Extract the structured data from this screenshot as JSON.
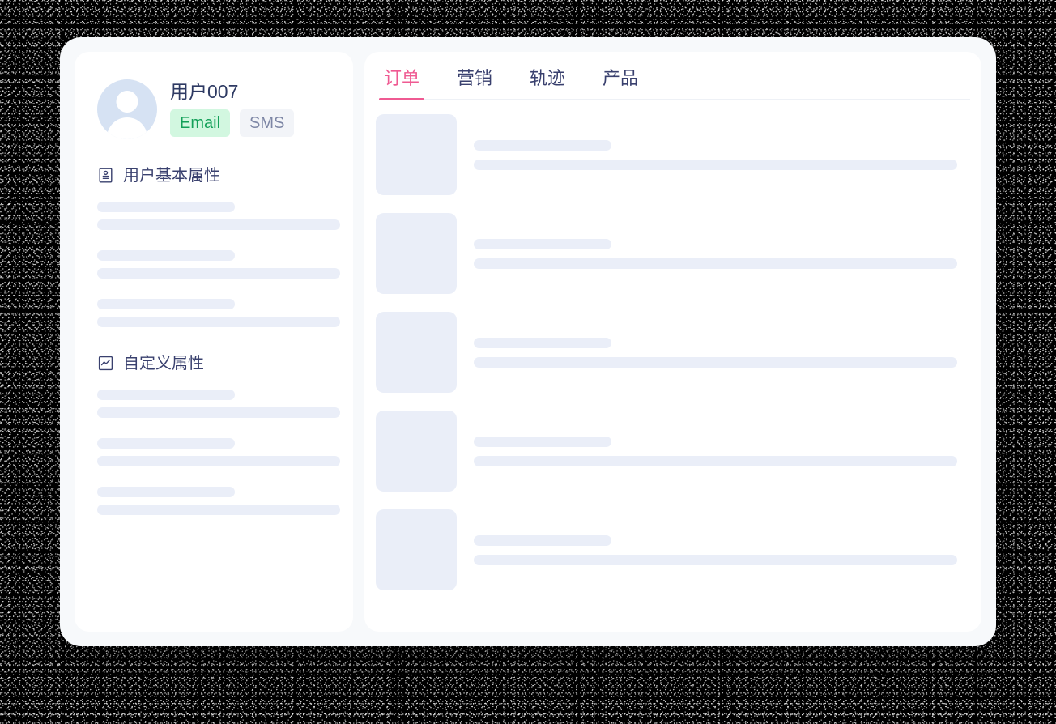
{
  "theme": {
    "accent_pink": "#ef5a92",
    "text_navy": "#39406e",
    "skeleton": "#eaeef8",
    "panel_bg": "#ffffff",
    "window_bg": "#f7f9fb",
    "badge_email_bg": "#d2f7e0",
    "badge_email_text": "#13a059",
    "badge_sms_bg": "#f2f4f8",
    "badge_sms_text": "#7d86a5",
    "avatar_bg": "#d6e2f3"
  },
  "sidebar": {
    "avatar_icon": "user-avatar-icon",
    "user_name": "用户007",
    "badges": [
      {
        "label": "Email",
        "style": "email"
      },
      {
        "label": "SMS",
        "style": "sms"
      }
    ],
    "sections": [
      {
        "icon": "id-card-icon",
        "title": "用户基本属性",
        "skeleton_pairs": 3
      },
      {
        "icon": "chart-line-square-icon",
        "title": "自定义属性",
        "skeleton_pairs": 3
      }
    ]
  },
  "main": {
    "tabs": [
      {
        "label": "订单",
        "active": true
      },
      {
        "label": "营销",
        "active": false
      },
      {
        "label": "轨迹",
        "active": false
      },
      {
        "label": "产品",
        "active": false
      }
    ],
    "rows": [
      {
        "thumb": "placeholder-thumbnail"
      },
      {
        "thumb": "placeholder-thumbnail"
      },
      {
        "thumb": "placeholder-thumbnail"
      },
      {
        "thumb": "placeholder-thumbnail"
      },
      {
        "thumb": "placeholder-thumbnail"
      }
    ]
  }
}
